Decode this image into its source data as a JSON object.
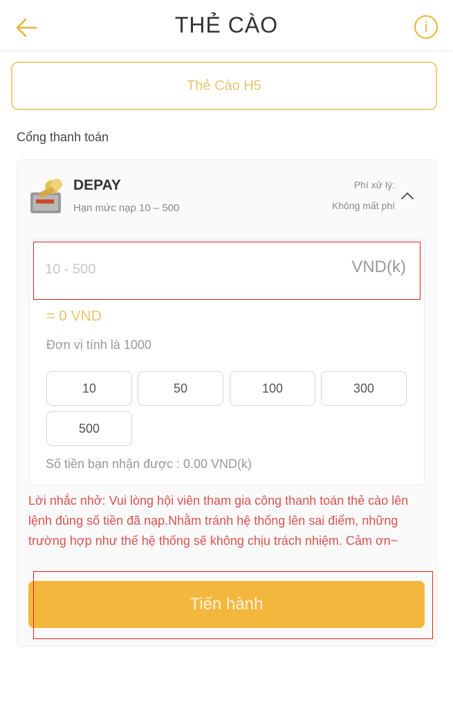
{
  "header": {
    "title": "THẺ CÀO",
    "back_icon": "arrow-left-icon",
    "info_icon": "info-icon",
    "info_glyph": "i",
    "accent_color": "#e6b532"
  },
  "method_tab": {
    "label": "Thẻ Cào H5"
  },
  "gateway": {
    "section_label": "Cổng thanh toán",
    "provider": {
      "name": "DEPAY",
      "limit": "Hạn mức nạp 10 – 500",
      "fee_label": "Phí xử lý:",
      "fee_value": "Không mất phí",
      "logo_icon": "depay-logo-icon",
      "toggle_icon": "chevron-up-icon"
    }
  },
  "amount": {
    "placeholder": "10 - 500",
    "value": "",
    "unit": "VND(k)",
    "converted": "= 0 VND",
    "unit_note": "Đơn vị tính là 1000"
  },
  "quick_amounts": [
    "10",
    "50",
    "100",
    "300",
    "500"
  ],
  "receive_text": "Số tiền bạn nhận được : 0.00 VND(k)",
  "reminder": {
    "text": "Lời nhắc nhở: Vui lòng hội viên tham gia công thanh toán thẻ cào lên lệnh đúng số tiền đã nạp.Nhằm tránh hệ thống lên sai điểm, những trường hợp như thế hệ thống sẽ không chịu trách nhiệm. Cảm ơn~",
    "color": "#d9534f"
  },
  "proceed_button": {
    "label": "Tiến hành",
    "color": "#f4b73e"
  }
}
